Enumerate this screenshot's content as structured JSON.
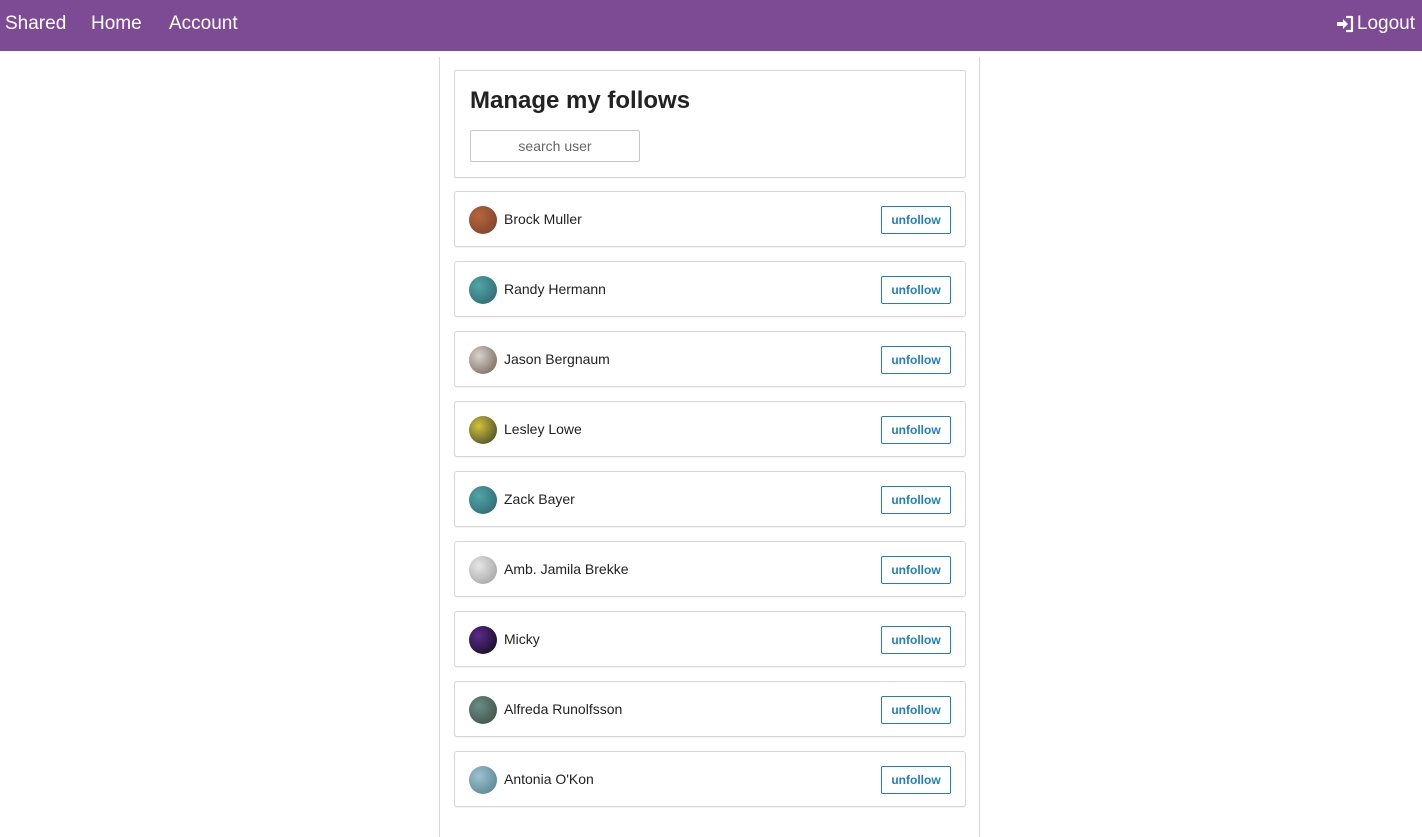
{
  "nav": {
    "brand": "Shared",
    "home": "Home",
    "account": "Account",
    "logout": "Logout",
    "logout_icon": "sign-in-icon",
    "bar_color": "#7d4a94"
  },
  "page": {
    "title": "Manage my follows",
    "search_placeholder": "search user"
  },
  "users": [
    {
      "name": "Brock Muller",
      "button": "unfollow",
      "avatar_colors": [
        "#b5673a",
        "#7a3b2a"
      ]
    },
    {
      "name": "Randy Hermann",
      "button": "unfollow",
      "avatar_colors": [
        "#4fa6a8",
        "#2d5f6a"
      ]
    },
    {
      "name": "Jason Bergnaum",
      "button": "unfollow",
      "avatar_colors": [
        "#d9d2cc",
        "#6b5a4d"
      ]
    },
    {
      "name": "Lesley Lowe",
      "button": "unfollow",
      "avatar_colors": [
        "#d4c238",
        "#2f3b29"
      ]
    },
    {
      "name": "Zack Bayer",
      "button": "unfollow",
      "avatar_colors": [
        "#4fa6a8",
        "#2d5f6a"
      ]
    },
    {
      "name": "Amb. Jamila Brekke",
      "button": "unfollow",
      "avatar_colors": [
        "#e6e6e6",
        "#9a9a9a"
      ]
    },
    {
      "name": "Micky",
      "button": "unfollow",
      "avatar_colors": [
        "#5b2b8a",
        "#0a0a14"
      ]
    },
    {
      "name": "Alfreda Runolfsson",
      "button": "unfollow",
      "avatar_colors": [
        "#6a8b86",
        "#3a4a3e"
      ]
    },
    {
      "name": "Antonia O'Kon",
      "button": "unfollow",
      "avatar_colors": [
        "#9fc2cf",
        "#4b7b8a"
      ]
    }
  ],
  "colors": {
    "accent_button": "#1f7fc0"
  }
}
